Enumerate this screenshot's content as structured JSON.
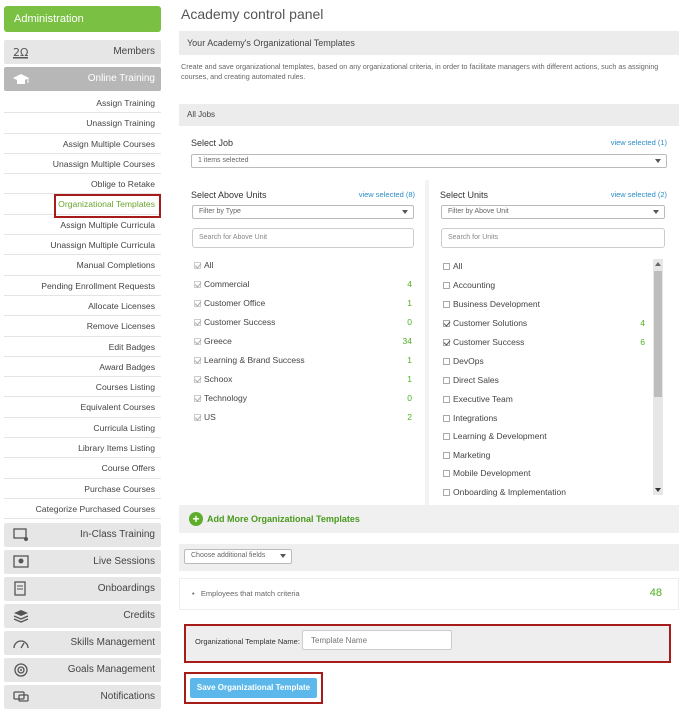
{
  "sidebar": {
    "header": "Administration",
    "nav_top": [
      {
        "label": "Members",
        "icon": "members-icon"
      },
      {
        "label": "Online Training",
        "icon": "graduation-cap-icon"
      }
    ],
    "sub_items": [
      "Assign Training",
      "Unassign Training",
      "Assign Multiple Courses",
      "Unassign Multiple Courses",
      "Oblige to Retake",
      "Organizational Templates",
      "Assign Multiple Curricula",
      "Unassign Multiple Curricula",
      "Manual Completions",
      "Pending Enrollment Requests",
      "Allocate Licenses",
      "Remove Licenses",
      "Edit Badges",
      "Award Badges",
      "Courses Listing",
      "Equivalent Courses",
      "Curricula Listing",
      "Library Items Listing",
      "Course Offers",
      "Purchase Courses",
      "Categorize Purchased Courses"
    ],
    "selected_sub": "Organizational Templates",
    "nav_bottom": [
      {
        "label": "In-Class Training",
        "icon": "classroom-icon"
      },
      {
        "label": "Live Sessions",
        "icon": "live-session-icon"
      },
      {
        "label": "Onboardings",
        "icon": "onboarding-icon"
      },
      {
        "label": "Credits",
        "icon": "credits-stack-icon"
      },
      {
        "label": "Skills Management",
        "icon": "gauge-icon"
      },
      {
        "label": "Goals Management",
        "icon": "target-icon"
      },
      {
        "label": "Notifications",
        "icon": "chat-bubbles-icon"
      }
    ]
  },
  "main": {
    "title": "Academy control panel",
    "section_title": "Your Academy's Organizational Templates",
    "description": "Create and save organizational templates, based on any organizational criteria, in order to facilitate managers with different actions, such as assigning courses, and creating automated rules.",
    "all_jobs_label": "All Jobs",
    "select_job": {
      "label": "Select Job",
      "link": "view selected (1)",
      "value": "1 items selected"
    },
    "above_units": {
      "label": "Select Above Units",
      "link": "view selected (8)",
      "filter": "Filter by Type",
      "search_placeholder": "Search for Above Unit",
      "all_label": "All",
      "items": [
        {
          "name": "Commercial",
          "count": "4"
        },
        {
          "name": "Customer Office",
          "count": "1"
        },
        {
          "name": "Customer Success",
          "count": "0"
        },
        {
          "name": "Greece",
          "count": "34"
        },
        {
          "name": "Learning & Brand Success",
          "count": "1"
        },
        {
          "name": "Schoox",
          "count": "1"
        },
        {
          "name": "Technology",
          "count": "0"
        },
        {
          "name": "US",
          "count": "2"
        }
      ]
    },
    "units": {
      "label": "Select Units",
      "link": "view selected (2)",
      "filter": "Filter by Above Unit",
      "search_placeholder": "Search for Units",
      "all_label": "All",
      "items": [
        {
          "name": "Accounting",
          "checked": false,
          "count": ""
        },
        {
          "name": "Business Development",
          "checked": false,
          "count": ""
        },
        {
          "name": "Customer Solutions",
          "checked": true,
          "count": "4"
        },
        {
          "name": "Customer Success",
          "checked": true,
          "count": "6"
        },
        {
          "name": "DevOps",
          "checked": false,
          "count": ""
        },
        {
          "name": "Direct Sales",
          "checked": false,
          "count": ""
        },
        {
          "name": "Executive Team",
          "checked": false,
          "count": ""
        },
        {
          "name": "Integrations",
          "checked": false,
          "count": ""
        },
        {
          "name": "Learning & Development",
          "checked": false,
          "count": ""
        },
        {
          "name": "Marketing",
          "checked": false,
          "count": ""
        },
        {
          "name": "Mobile Development",
          "checked": false,
          "count": ""
        },
        {
          "name": "Onboarding & Implementation",
          "checked": false,
          "count": ""
        }
      ]
    },
    "add_more": "Add More Organizational Templates",
    "additional_fields": "Choose additional fields",
    "matches": {
      "label": "Employees that match criteria",
      "count": "48"
    },
    "template_name": {
      "label": "Organizational Template Name:",
      "placeholder": "Template Name"
    },
    "save_button": "Save Organizational Template"
  }
}
